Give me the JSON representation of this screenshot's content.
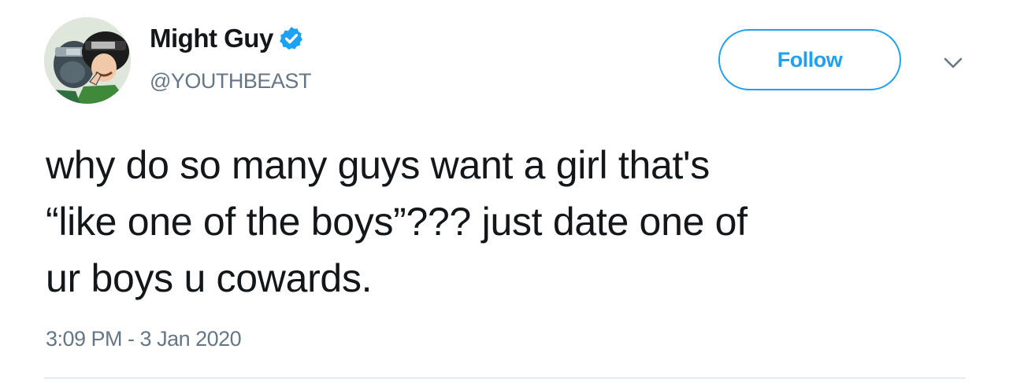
{
  "author": {
    "display_name": "Might Guy",
    "handle": "@YOUTHBEAST",
    "verified": true,
    "avatar_icon": "anime-avatar-icon"
  },
  "actions": {
    "follow_label": "Follow",
    "more_icon": "chevron-down-icon"
  },
  "tweet": {
    "text_lines": [
      "why do so many guys want a girl that's",
      "“like one of the boys”??? just date one of",
      "ur boys u cowards."
    ],
    "timestamp": "3:09 PM - 3 Jan 2020"
  },
  "colors": {
    "accent": "#1da1f2",
    "text": "#14171a",
    "secondary_text": "#657786",
    "divider": "#e6ecf0"
  }
}
